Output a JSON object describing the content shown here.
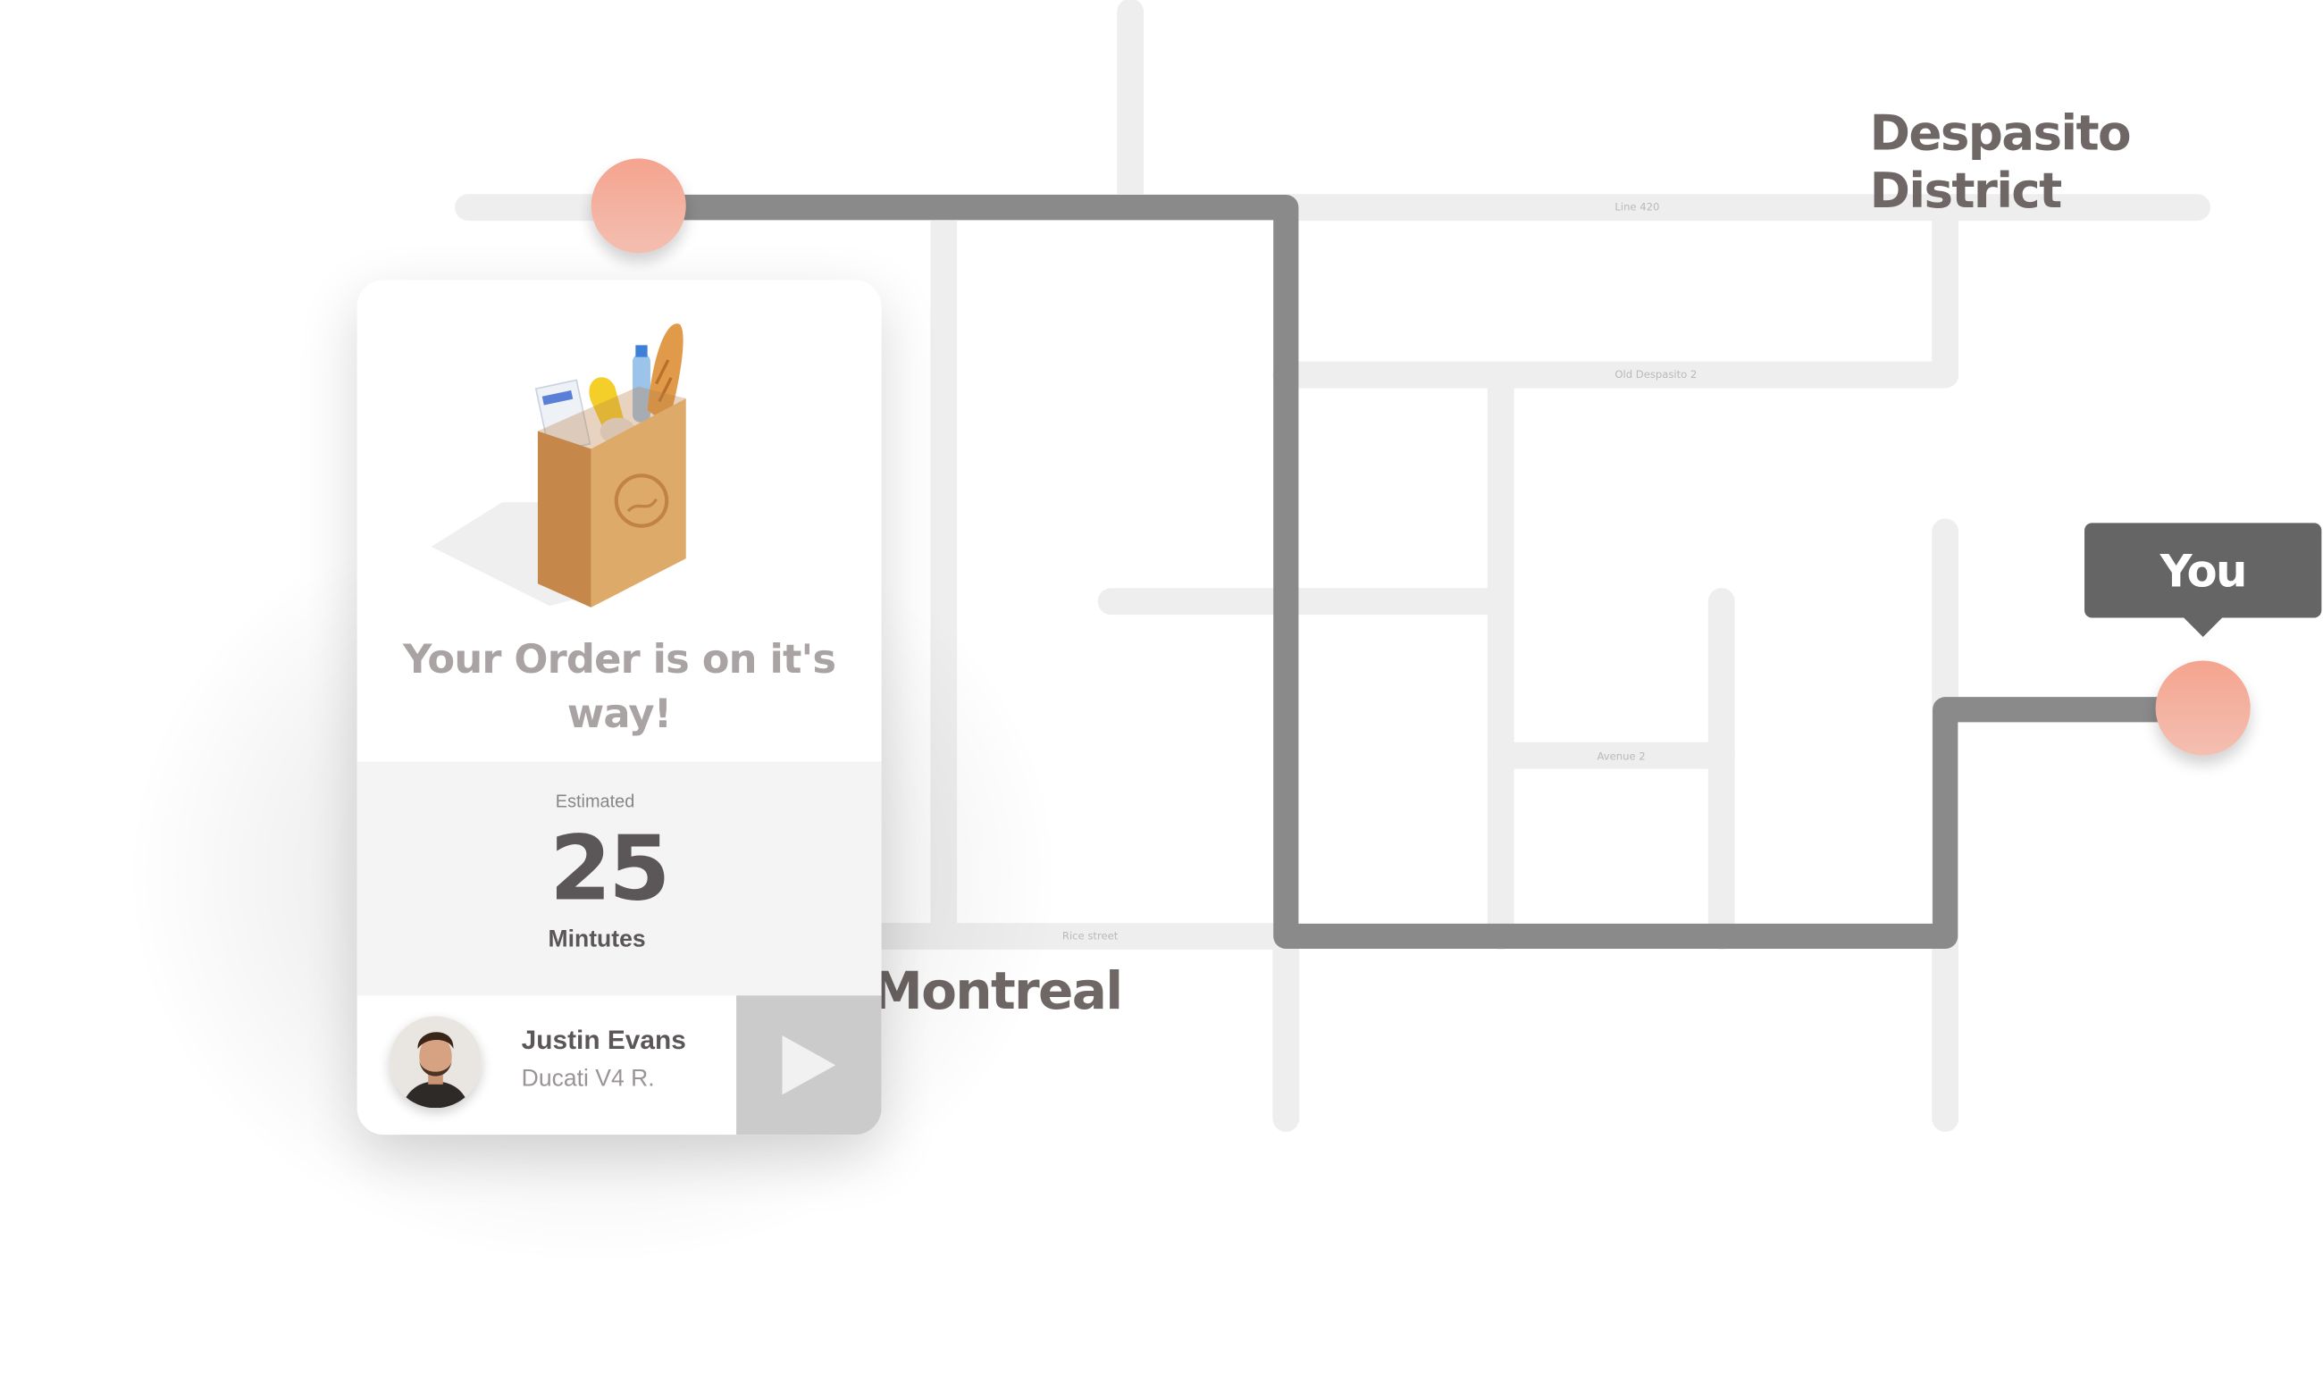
{
  "map": {
    "districts": {
      "top_right": "Despasito District",
      "bottom_left": "Montreal"
    },
    "street_labels": {
      "line420": "Line 420",
      "old_despasito": "Old Despasito 2",
      "avenue2": "Avenue 2",
      "rice_street": "Rice street"
    },
    "you_label": "You",
    "colors": {
      "route": "#8a8a8a",
      "street": "#eeeeee",
      "pin": "#f4a48f",
      "bubble": "#656565"
    }
  },
  "order_card": {
    "title": "Your Order is on it's way!",
    "estimate": {
      "label": "Estimated",
      "value": "25",
      "unit": "Mintutes"
    },
    "driver": {
      "name": "Justin Evans",
      "vehicle": "Ducati V4 R."
    },
    "icons": {
      "illustration": "grocery-bag-illustration",
      "action": "play-icon",
      "avatar": "driver-avatar"
    }
  }
}
